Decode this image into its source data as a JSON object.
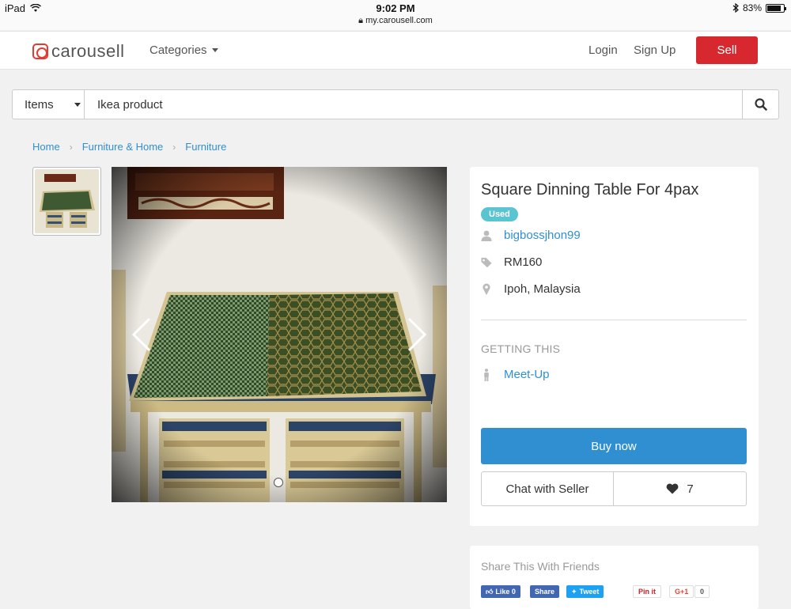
{
  "status_bar": {
    "device": "iPad",
    "time": "9:02 PM",
    "url": "my.carousell.com",
    "battery": "83%",
    "battery_level": 0.83
  },
  "nav": {
    "logo_text": "carousell",
    "categories_label": "Categories",
    "login": "Login",
    "signup": "Sign Up",
    "sell": "Sell"
  },
  "search": {
    "scope": "Items",
    "query": "Ikea product"
  },
  "breadcrumb": [
    "Home",
    "Furniture & Home",
    "Furniture"
  ],
  "listing": {
    "title": "Square Dinning Table For 4pax",
    "condition": "Used",
    "seller": "bigbossjhon99",
    "price": "RM160",
    "location": "Ipoh, Malaysia",
    "getting_heading": "GETTING THIS",
    "delivery": "Meet-Up",
    "buy_now": "Buy now",
    "chat": "Chat with Seller",
    "likes": "7"
  },
  "share": {
    "heading": "Share This With Friends",
    "buttons": {
      "fb_like": "Like 0",
      "fb_share": "Share",
      "tweet": "Tweet",
      "pin": "Pin it",
      "gplus": "G+1",
      "gplus_count": "0"
    }
  },
  "colors": {
    "brand_red": "#d7282f",
    "link_blue": "#2f8fd1",
    "badge_teal": "#5bc4d1"
  }
}
